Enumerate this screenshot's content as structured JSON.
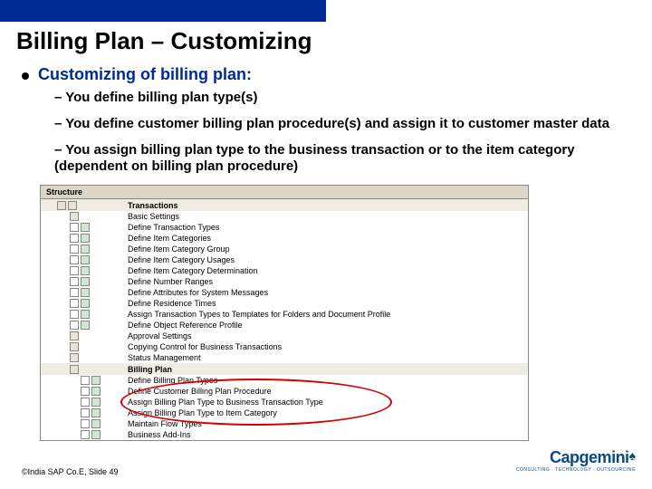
{
  "title": "Billing Plan – Customizing",
  "section_head": "Customizing of billing plan:",
  "bullets": [
    "You define billing plan type(s)",
    "You define customer billing plan procedure(s) and assign it to customer master data",
    "You assign billing plan type to the business transaction or to the item category (dependent on billing plan procedure)"
  ],
  "ss": {
    "header": "Structure",
    "group1_title": "Transactions",
    "group1_sub": "Basic Settings",
    "group1": [
      "Define Transaction Types",
      "Define Item Categories",
      "Define Item Category Group",
      "Define Item Category Usages",
      "Define Item Category Determination",
      "Define Number Ranges",
      "Define Attributes for System Messages",
      "Define Residence Times",
      "Assign Transaction Types to Templates for Folders and Document Profile",
      "Define Object Reference Profile"
    ],
    "misc": [
      "Approval Settings",
      "Copying Control for Business Transactions",
      "Status Management"
    ],
    "group2_title": "Billing Plan",
    "group2": [
      "Define Billing Plan Types",
      "Define Customer Billing Plan Procedure",
      "Assign Billing Plan Type to Business Transaction Type",
      "Assign Billing Plan Type to Item Category",
      "Maintain Flow Types",
      "Business Add-Ins"
    ]
  },
  "footer": "©India SAP Co.E, Slide 49",
  "logo": {
    "main": "Capgemini",
    "sub": "CONSULTING · TECHNOLOGY · OUTSOURCING"
  }
}
